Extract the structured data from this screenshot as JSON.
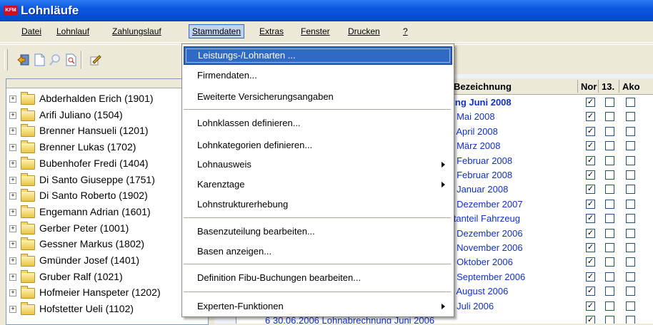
{
  "window": {
    "title": "Lohnläufe",
    "app_badge": "KFM"
  },
  "menubar": {
    "items": [
      "Datei",
      "Lohnlauf",
      "Zahlungslauf",
      "Stammdaten",
      "Extras",
      "Fenster",
      "Drucken",
      "?"
    ],
    "active": "Stammdaten"
  },
  "toolbar": {
    "icons": [
      "exit-icon",
      "new-document-icon",
      "search-icon",
      "find-document-icon",
      "edit-icon"
    ]
  },
  "tree": {
    "items": [
      "Abderhalden Erich (1901)",
      "Arifi Juliano (1504)",
      "Brenner Hansueli (1201)",
      "Brenner Lukas (1702)",
      "Bubenhofer Fredi (1404)",
      "Di Santo Giuseppe (1751)",
      "Di Santo Roberto (1902)",
      "Engemann Adrian (1601)",
      "Gerber Peter (1001)",
      "Gessner Markus (1802)",
      "Gmünder Josef (1401)",
      "Gruber Ralf (1021)",
      "Hofmeier Hanspeter (1202)",
      "Hofstetter Ueli (1102)"
    ]
  },
  "grid": {
    "headers": [
      "Bezeichnung",
      "Nor",
      "13.",
      "Ako"
    ],
    "rows": [
      {
        "text": "nung Juni 2008",
        "bold": true
      },
      {
        "text": "ng Mai 2008",
        "bold": false
      },
      {
        "text": "ng April 2008",
        "bold": false
      },
      {
        "text": "ng März 2008",
        "bold": false
      },
      {
        "text": "ng Februar 2008",
        "bold": false
      },
      {
        "text": "ng Februar 2008",
        "bold": false
      },
      {
        "text": "ng Januar 2008",
        "bold": false
      },
      {
        "text": "ng Dezember 2007",
        "bold": false
      },
      {
        "text": "vatanteil Fahrzeug",
        "bold": false
      },
      {
        "text": "ng Dezember 2006",
        "bold": false
      },
      {
        "text": "ng November 2006",
        "bold": false
      },
      {
        "text": "ng Oktober 2006",
        "bold": false
      },
      {
        "text": "ng September 2006",
        "bold": false
      },
      {
        "text": "ng August 2006",
        "bold": false
      },
      {
        "text": "ng Juli 2006",
        "bold": false
      },
      {
        "text": "6 30.06.2006 Lohnabrechnung Juni 2006",
        "bold": false
      }
    ],
    "check_mark": "✓"
  },
  "dropdown": {
    "items": [
      {
        "label": "Leistungs-/Lohnarten ...",
        "submenu": false,
        "highlight": true
      },
      {
        "label": "Firmendaten...",
        "submenu": false
      },
      {
        "label": "Eweiterte Versicherungsangaben",
        "submenu": false
      },
      {
        "label": "Lohnklassen definieren...",
        "submenu": false
      },
      {
        "label": "Lohnkategorien definieren...",
        "submenu": false
      },
      {
        "label": "Lohnausweis",
        "submenu": true
      },
      {
        "label": "Karenztage",
        "submenu": true
      },
      {
        "label": "Lohnstrukturerhebung",
        "submenu": false
      },
      {
        "label": "Basenzuteilung bearbeiten...",
        "submenu": false
      },
      {
        "label": "Basen anzeigen...",
        "submenu": false
      },
      {
        "label": "Definition Fibu-Buchungen bearbeiten...",
        "submenu": false
      },
      {
        "label": "Experten-Funktionen",
        "submenu": true
      }
    ]
  },
  "colors": {
    "title_bar": "#0a57e0",
    "highlight": "#316ac5",
    "link_text": "#1030c8",
    "menu_bg": "#ece9d8"
  }
}
